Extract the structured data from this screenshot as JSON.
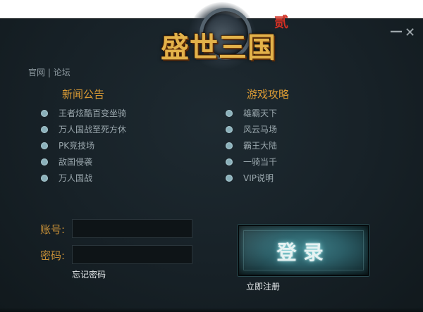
{
  "logo": {
    "title": "盛世三国",
    "seal": "贰"
  },
  "window": {
    "minimize_glyph": "—",
    "close_glyph": "✕"
  },
  "links": {
    "official": "官网",
    "separator": "|",
    "forum": "论坛"
  },
  "news": {
    "heading": "新闻公告",
    "items": [
      {
        "label": "王者炫酷百变坐骑"
      },
      {
        "label": "万人国战至死方休"
      },
      {
        "label": "PK竞技场"
      },
      {
        "label": "敌国侵袭"
      },
      {
        "label": "万人国战"
      }
    ]
  },
  "guide": {
    "heading": "游戏攻略",
    "items": [
      {
        "label": "雄霸天下"
      },
      {
        "label": "风云马场"
      },
      {
        "label": "霸王大陆"
      },
      {
        "label": "一骑当千"
      },
      {
        "label": "VIP说明"
      }
    ]
  },
  "login": {
    "account_label": "账号:",
    "account_value": "",
    "password_label": "密码:",
    "password_value": "",
    "forgot": "忘记密码",
    "button": "登录",
    "register": "立即注册"
  },
  "colors": {
    "background": "#172127",
    "accent_gold": "#d99a34",
    "button_teal": "#2b5d66",
    "bullet": "#8ab0ba"
  }
}
